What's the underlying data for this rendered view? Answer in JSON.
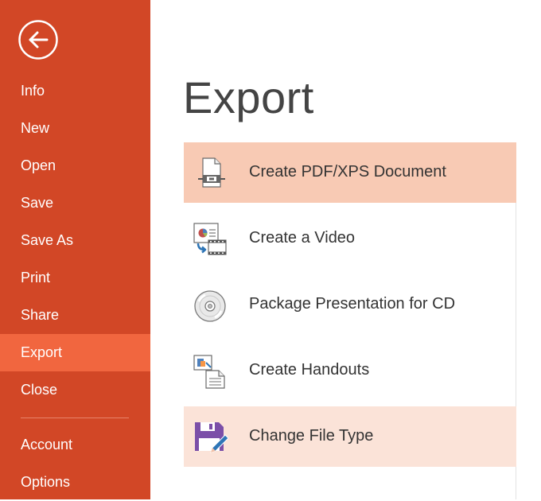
{
  "sidebar": {
    "back_icon": "back-arrow-icon",
    "items": [
      {
        "label": "Info",
        "active": false
      },
      {
        "label": "New",
        "active": false
      },
      {
        "label": "Open",
        "active": false
      },
      {
        "label": "Save",
        "active": false
      },
      {
        "label": "Save As",
        "active": false
      },
      {
        "label": "Print",
        "active": false
      },
      {
        "label": "Share",
        "active": false
      },
      {
        "label": "Export",
        "active": true
      },
      {
        "label": "Close",
        "active": false
      }
    ],
    "bottom_items": [
      {
        "label": "Account"
      },
      {
        "label": "Options"
      }
    ]
  },
  "main": {
    "title": "Export",
    "options": [
      {
        "label": "Create PDF/XPS Document",
        "icon": "pdf-document-icon",
        "state": "selected"
      },
      {
        "label": "Create a Video",
        "icon": "video-icon",
        "state": "normal"
      },
      {
        "label": "Package Presentation for CD",
        "icon": "cd-icon",
        "state": "normal"
      },
      {
        "label": "Create Handouts",
        "icon": "handouts-icon",
        "state": "normal"
      },
      {
        "label": "Change File Type",
        "icon": "save-file-type-icon",
        "state": "hover"
      }
    ]
  },
  "colors": {
    "sidebar_bg": "#D24726",
    "sidebar_active": "#F1663F",
    "option_selected": "#F8CAB4",
    "option_hover": "#FBE3D8"
  }
}
